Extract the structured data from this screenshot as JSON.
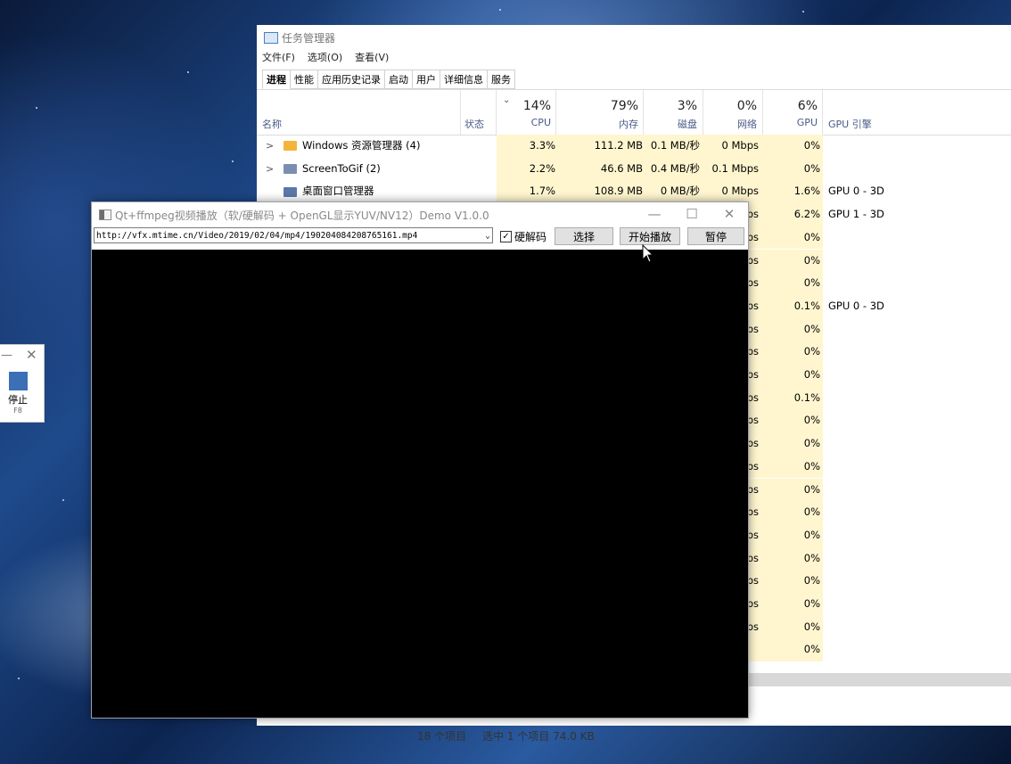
{
  "taskmanager": {
    "title": "任务管理器",
    "menu": [
      "文件(F)",
      "选项(O)",
      "查看(V)"
    ],
    "tabs": [
      "进程",
      "性能",
      "应用历史记录",
      "启动",
      "用户",
      "详细信息",
      "服务"
    ],
    "columns": {
      "name": "名称",
      "status": "状态",
      "cpu": {
        "pct": "14%",
        "label": "CPU"
      },
      "mem": {
        "pct": "79%",
        "label": "内存"
      },
      "disk": {
        "pct": "3%",
        "label": "磁盘"
      },
      "net": {
        "pct": "0%",
        "label": "网络"
      },
      "gpu": {
        "pct": "6%",
        "label": "GPU"
      },
      "engine": "GPU 引擎"
    },
    "rows": [
      {
        "name": "Windows 资源管理器 (4)",
        "expand": true,
        "cpu": "3.3%",
        "mem": "111.2 MB",
        "disk": "0.1 MB/秒",
        "net": "0 Mbps",
        "gpu": "0%",
        "engine": ""
      },
      {
        "name": "ScreenToGif (2)",
        "expand": true,
        "cpu": "2.2%",
        "mem": "46.6 MB",
        "disk": "0.4 MB/秒",
        "net": "0.1 Mbps",
        "gpu": "0%",
        "engine": ""
      },
      {
        "name": "桌面窗口管理器",
        "expand": false,
        "cpu": "1.7%",
        "mem": "108.9 MB",
        "disk": "0 MB/秒",
        "net": "0 Mbps",
        "gpu": "1.6%",
        "engine": "GPU 0 - 3D"
      },
      {
        "net": "ps",
        "gpu": "6.2%",
        "engine": "GPU 1 - 3D"
      },
      {
        "net": "ps",
        "gpu": "0%",
        "engine": ""
      },
      {
        "net": "ps",
        "gpu": "0%",
        "engine": ""
      },
      {
        "net": "ps",
        "gpu": "0%",
        "engine": ""
      },
      {
        "net": "ps",
        "gpu": "0.1%",
        "engine": "GPU 0 - 3D"
      },
      {
        "net": "ps",
        "gpu": "0%",
        "engine": ""
      },
      {
        "net": "ps",
        "gpu": "0%",
        "engine": ""
      },
      {
        "net": "ps",
        "gpu": "0%",
        "engine": ""
      },
      {
        "net": "ps",
        "gpu": "0.1%",
        "engine": ""
      },
      {
        "net": "ps",
        "gpu": "0%",
        "engine": ""
      },
      {
        "net": "ps",
        "gpu": "0%",
        "engine": ""
      },
      {
        "net": "ps",
        "gpu": "0%",
        "engine": ""
      },
      {
        "net": "ps",
        "gpu": "0%",
        "engine": ""
      },
      {
        "net": "ps",
        "gpu": "0%",
        "engine": ""
      },
      {
        "net": "ps",
        "gpu": "0%",
        "engine": ""
      },
      {
        "net": "ps",
        "gpu": "0%",
        "engine": ""
      },
      {
        "net": "ps",
        "gpu": "0%",
        "engine": ""
      },
      {
        "net": "ps",
        "gpu": "0%",
        "engine": ""
      },
      {
        "net": "ps",
        "gpu": "0%",
        "engine": ""
      },
      {
        "net": "",
        "gpu": "0%",
        "engine": ""
      }
    ],
    "status": {
      "count": "18 个项目",
      "selected": "选中 1 个项目 74.0 KB"
    }
  },
  "mini": {
    "stop_label": "停止",
    "key": "F8"
  },
  "player": {
    "title": "Qt+ffmpeg视频播放（软/硬解码 + OpenGL显示YUV/NV12）Demo V1.0.0",
    "url": "http://vfx.mtime.cn/Video/2019/02/04/mp4/190204084208765161.mp4",
    "hw_label": "硬解码",
    "hw_checked": true,
    "buttons": {
      "select": "选择",
      "play": "开始播放",
      "pause": "暂停"
    }
  }
}
